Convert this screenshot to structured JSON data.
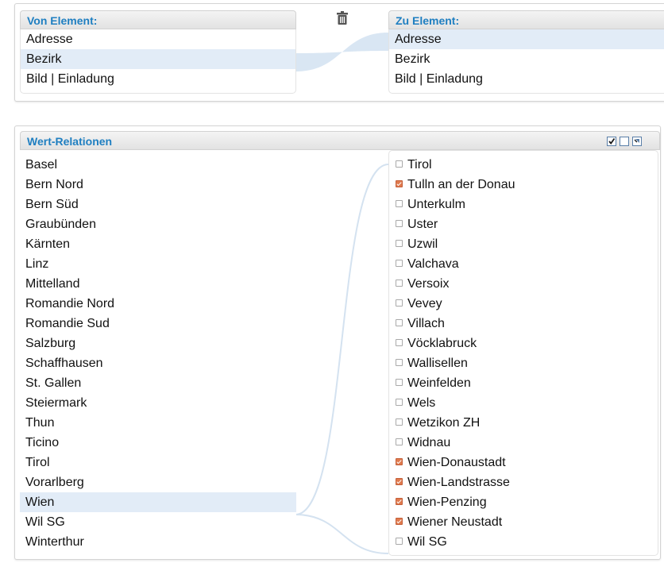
{
  "mapping": {
    "from_header": "Von Element:",
    "to_header": "Zu Element:",
    "from_items": [
      {
        "label": "Adresse",
        "selected": false
      },
      {
        "label": "Bezirk",
        "selected": true
      },
      {
        "label": "Bild | Einladung",
        "selected": false
      }
    ],
    "to_items": [
      {
        "label": "Adresse",
        "selected": true
      },
      {
        "label": "Bezirk",
        "selected": false
      },
      {
        "label": "Bild | Einladung",
        "selected": false
      }
    ],
    "delete_icon": "trash-icon"
  },
  "relations": {
    "header": "Wert-Relationen",
    "tool_icons": [
      "check-all-icon",
      "uncheck-all-icon",
      "invert-selection-icon"
    ],
    "left_items": [
      {
        "label": "Basel",
        "selected": false
      },
      {
        "label": "Bern Nord",
        "selected": false
      },
      {
        "label": "Bern Süd",
        "selected": false
      },
      {
        "label": "Graubünden",
        "selected": false
      },
      {
        "label": "Kärnten",
        "selected": false
      },
      {
        "label": "Linz",
        "selected": false
      },
      {
        "label": "Mittelland",
        "selected": false
      },
      {
        "label": "Romandie Nord",
        "selected": false
      },
      {
        "label": "Romandie Sud",
        "selected": false
      },
      {
        "label": "Salzburg",
        "selected": false
      },
      {
        "label": "Schaffhausen",
        "selected": false
      },
      {
        "label": "St. Gallen",
        "selected": false
      },
      {
        "label": "Steiermark",
        "selected": false
      },
      {
        "label": "Thun",
        "selected": false
      },
      {
        "label": "Ticino",
        "selected": false
      },
      {
        "label": "Tirol",
        "selected": false
      },
      {
        "label": "Vorarlberg",
        "selected": false
      },
      {
        "label": "Wien",
        "selected": true
      },
      {
        "label": "Wil SG",
        "selected": false
      },
      {
        "label": "Winterthur",
        "selected": false
      }
    ],
    "right_items": [
      {
        "label": "Tirol",
        "checked": false
      },
      {
        "label": "Tulln an der Donau",
        "checked": true
      },
      {
        "label": "Unterkulm",
        "checked": false
      },
      {
        "label": "Uster",
        "checked": false
      },
      {
        "label": "Uzwil",
        "checked": false
      },
      {
        "label": "Valchava",
        "checked": false
      },
      {
        "label": "Versoix",
        "checked": false
      },
      {
        "label": "Vevey",
        "checked": false
      },
      {
        "label": "Villach",
        "checked": false
      },
      {
        "label": "Vöcklabruck",
        "checked": false
      },
      {
        "label": "Wallisellen",
        "checked": false
      },
      {
        "label": "Weinfelden",
        "checked": false
      },
      {
        "label": "Wels",
        "checked": false
      },
      {
        "label": "Wetzikon ZH",
        "checked": false
      },
      {
        "label": "Widnau",
        "checked": false
      },
      {
        "label": "Wien-Donaustadt",
        "checked": true
      },
      {
        "label": "Wien-Landstrasse",
        "checked": true
      },
      {
        "label": "Wien-Penzing",
        "checked": true
      },
      {
        "label": "Wiener Neustadt",
        "checked": true
      },
      {
        "label": "Wil SG",
        "checked": false
      }
    ]
  },
  "colors": {
    "header_text": "#1f7fc1",
    "selection": "#e2ecf7",
    "checkbox_checked": "#e07a4e",
    "connector": "#cfe0f0"
  }
}
